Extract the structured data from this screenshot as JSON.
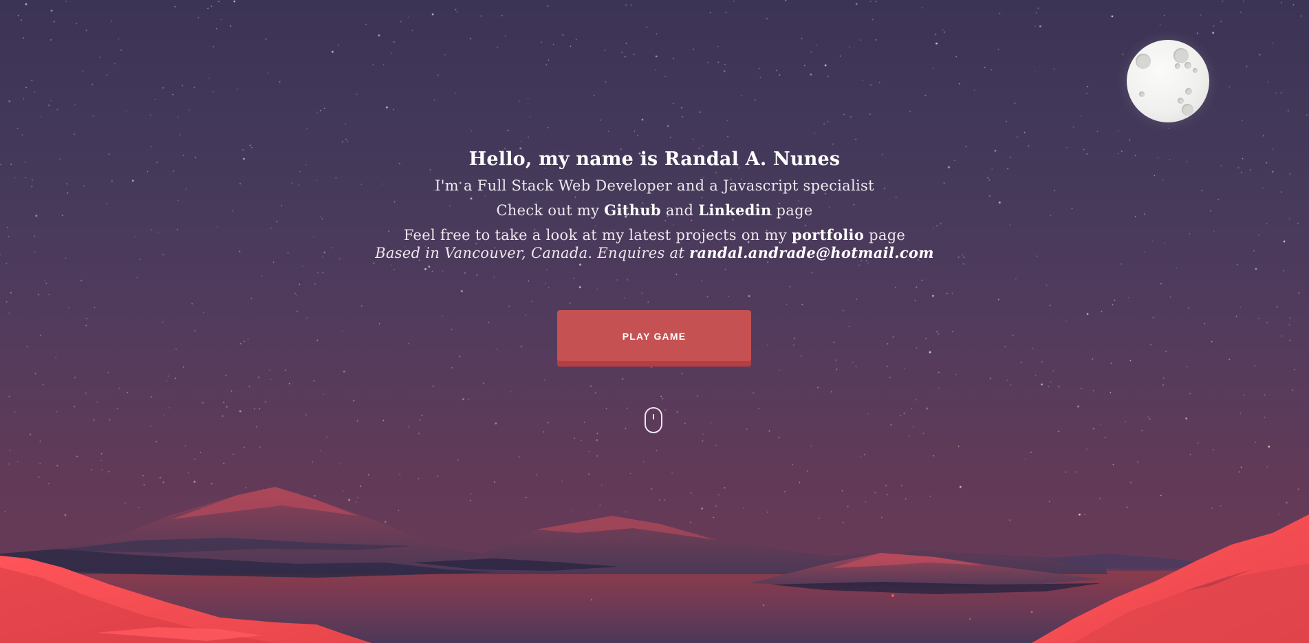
{
  "intro": {
    "greeting": "Hello, my name is Randal A. Nunes",
    "tagline": "I'm a Full Stack Web Developer and a Javascript specialist",
    "social": {
      "prefix": "Check out my",
      "github": "Github",
      "middle": "and",
      "linkedin": "Linkedin",
      "suffix": "page"
    },
    "projects": {
      "prefix": "Feel free to take a look at my latest projects on my",
      "portfolio": "portfolio",
      "suffix": "page"
    },
    "location": {
      "text": "Based in Vancouver, Canada. Enquires at",
      "email": "randal.andrade@hotmail.com"
    }
  },
  "actions": {
    "play_game": "PLAY GAME"
  },
  "icons": {
    "moon": "moon-icon",
    "scroll": "mouse-scroll-icon"
  },
  "colors": {
    "sky_top": "#3c3455",
    "sky_bottom": "#6a3a55",
    "button": "#c65152",
    "mountain_red": "#f24b4f",
    "moon": "#f0f0ee"
  }
}
